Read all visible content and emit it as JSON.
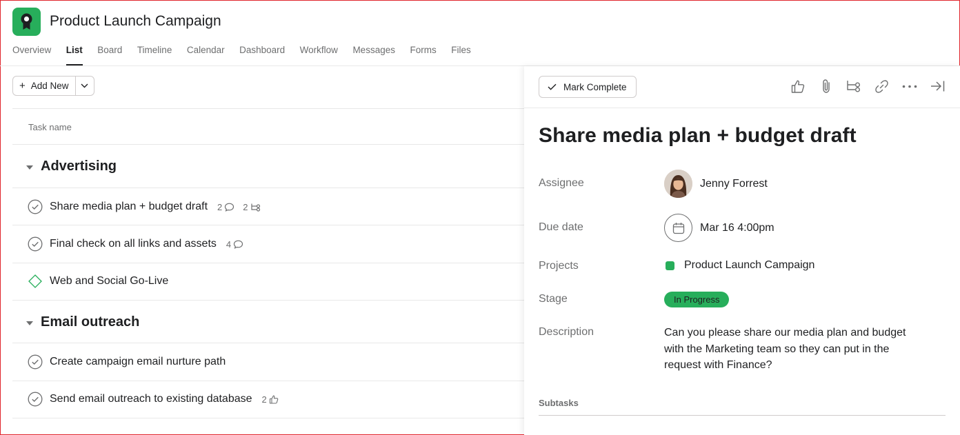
{
  "project": {
    "title": "Product Launch Campaign",
    "icon": "project-badge-icon",
    "color": "#27ae5b"
  },
  "tabs": [
    {
      "label": "Overview",
      "active": false
    },
    {
      "label": "List",
      "active": true
    },
    {
      "label": "Board",
      "active": false
    },
    {
      "label": "Timeline",
      "active": false
    },
    {
      "label": "Calendar",
      "active": false
    },
    {
      "label": "Dashboard",
      "active": false
    },
    {
      "label": "Workflow",
      "active": false
    },
    {
      "label": "Messages",
      "active": false
    },
    {
      "label": "Forms",
      "active": false
    },
    {
      "label": "Files",
      "active": false
    }
  ],
  "toolbar": {
    "add_new_label": "Add New"
  },
  "list": {
    "column_header": "Task name",
    "sections": [
      {
        "name": "Advertising",
        "tasks": [
          {
            "name": "Share media plan + budget draft",
            "comments": "2",
            "subtasks": "2",
            "icon": "check-circle-icon"
          },
          {
            "name": "Final check on all links and assets",
            "comments": "4",
            "icon": "check-circle-icon"
          },
          {
            "name": "Web and Social Go-Live",
            "icon": "milestone-diamond-icon"
          }
        ]
      },
      {
        "name": "Email outreach",
        "tasks": [
          {
            "name": "Create campaign email nurture path",
            "icon": "check-circle-icon"
          },
          {
            "name": "Send email outreach to existing database",
            "likes": "2",
            "icon": "check-circle-icon"
          }
        ]
      }
    ]
  },
  "detail": {
    "mark_complete_label": "Mark Complete",
    "title": "Share media plan + budget draft",
    "fields": {
      "assignee_label": "Assignee",
      "assignee_value": "Jenny Forrest",
      "due_label": "Due date",
      "due_value": "Mar 16 4:00pm",
      "projects_label": "Projects",
      "projects_value": "Product Launch Campaign",
      "stage_label": "Stage",
      "stage_value": "In Progress",
      "description_label": "Description",
      "description_value": "Can you please share our media plan and budget with the Marketing team so they can put in the request with Finance?"
    },
    "subtasks_label": "Subtasks",
    "stage_color": "#27ae5b"
  }
}
